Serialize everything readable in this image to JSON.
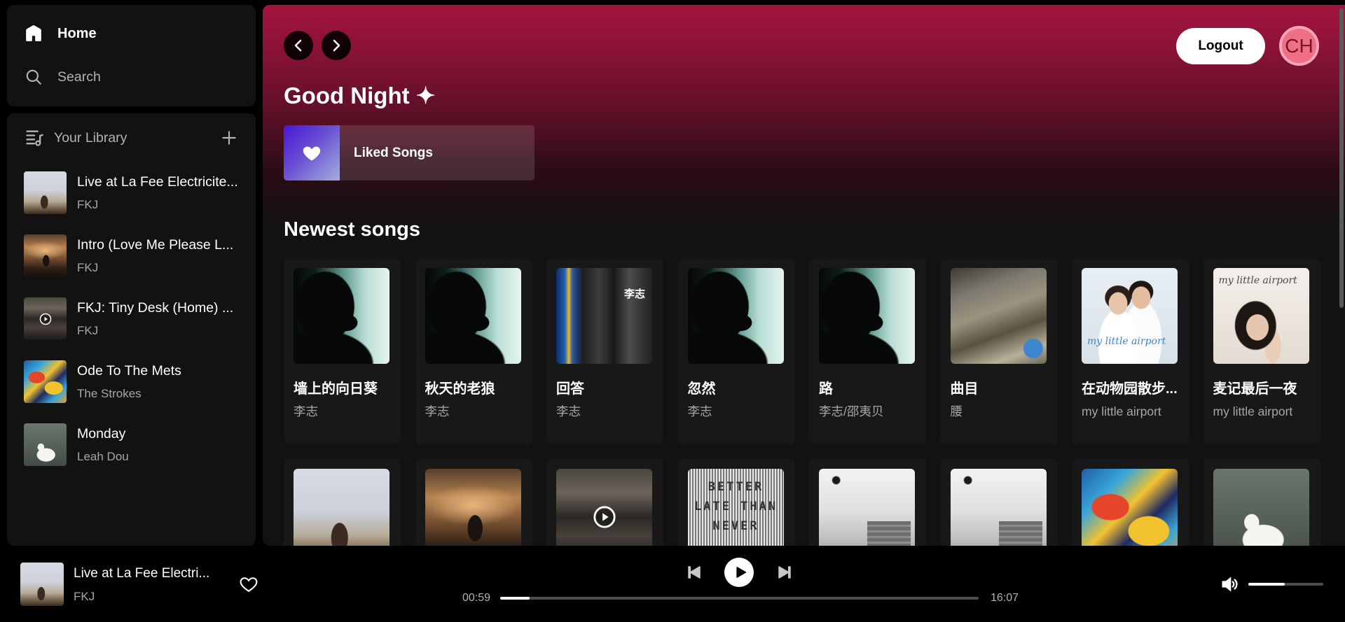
{
  "sidebar": {
    "nav": {
      "home": {
        "label": "Home",
        "icon": "home-icon"
      },
      "search": {
        "label": "Search",
        "icon": "search-icon"
      }
    },
    "library": {
      "title": "Your Library",
      "icon": "library-icon",
      "add_icon": "plus-icon",
      "items": [
        {
          "title": "Live at La Fee Electricite...",
          "subtitle": "FKJ"
        },
        {
          "title": "Intro (Love Me Please L...",
          "subtitle": "FKJ"
        },
        {
          "title": "FKJ: Tiny Desk (Home) ...",
          "subtitle": "FKJ"
        },
        {
          "title": "Ode To The Mets",
          "subtitle": "The Strokes"
        },
        {
          "title": "Monday",
          "subtitle": "Leah Dou"
        }
      ]
    }
  },
  "header": {
    "back_icon": "chevron-left-icon",
    "forward_icon": "chevron-right-icon",
    "logout_label": "Logout",
    "avatar_initials": "CH",
    "greeting": "Good Night ✦"
  },
  "quick_access": {
    "liked_songs": {
      "label": "Liked Songs",
      "icon": "heart-icon"
    }
  },
  "newest": {
    "title": "Newest songs",
    "songs": [
      {
        "title": "墙上的向日葵",
        "artist": "李志"
      },
      {
        "title": "秋天的老狼",
        "artist": "李志"
      },
      {
        "title": "回答",
        "artist": "李志"
      },
      {
        "title": "忽然",
        "artist": "李志"
      },
      {
        "title": "路",
        "artist": "李志/邵夷贝"
      },
      {
        "title": "曲目",
        "artist": "腰"
      },
      {
        "title": "在动物园散步...",
        "artist": "my little airport"
      },
      {
        "title": "麦记最后一夜",
        "artist": "my little airport"
      }
    ]
  },
  "cover_text": {
    "huida": "李志",
    "mla": "my little airport",
    "better": "BETTER LATE THAN NEVER"
  },
  "player": {
    "title": "Live at La Fee Electri...",
    "artist": "FKJ",
    "current_time": "00:59",
    "total_time": "16:07",
    "progress": 0.061,
    "volume": 0.49,
    "icons": {
      "like": "heart-outline-icon",
      "prev": "skip-back-icon",
      "play": "play-icon",
      "next": "skip-forward-icon",
      "volume": "volume-icon"
    }
  },
  "colors": {
    "accent": "#a3143f",
    "background": "#000000",
    "panel": "#121212",
    "card": "#181818",
    "text_muted": "#b3b3b3",
    "avatar": "#ee6f86"
  }
}
